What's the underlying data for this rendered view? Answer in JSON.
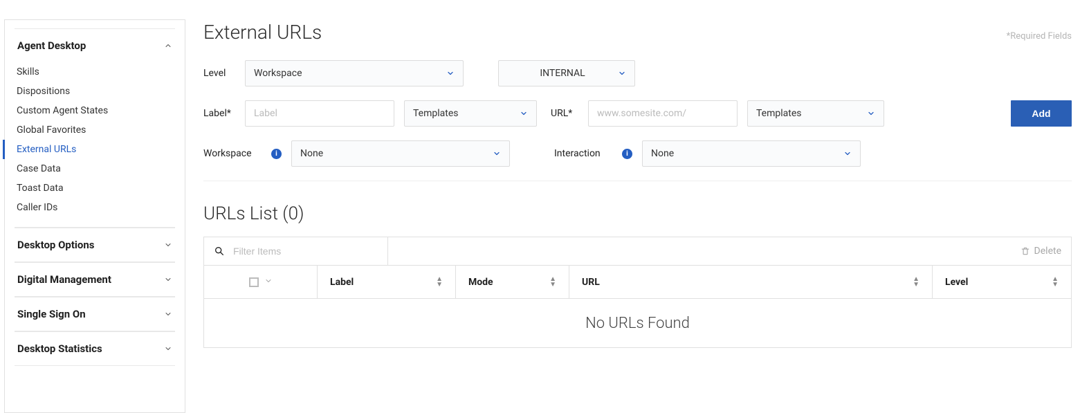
{
  "sidebar": {
    "sections": [
      {
        "title": "Agent Desktop",
        "expanded": true,
        "items": [
          {
            "label": "Skills",
            "active": false
          },
          {
            "label": "Dispositions",
            "active": false
          },
          {
            "label": "Custom Agent States",
            "active": false
          },
          {
            "label": "Global Favorites",
            "active": false
          },
          {
            "label": "External URLs",
            "active": true
          },
          {
            "label": "Case Data",
            "active": false
          },
          {
            "label": "Toast Data",
            "active": false
          },
          {
            "label": "Caller IDs",
            "active": false
          }
        ]
      },
      {
        "title": "Desktop Options",
        "expanded": false,
        "items": []
      },
      {
        "title": "Digital Management",
        "expanded": false,
        "items": []
      },
      {
        "title": "Single Sign On",
        "expanded": false,
        "items": []
      },
      {
        "title": "Desktop Statistics",
        "expanded": false,
        "items": []
      }
    ]
  },
  "page": {
    "title": "External URLs",
    "required_fields_note": "*Required Fields"
  },
  "form": {
    "level": {
      "label": "Level",
      "value": "Workspace"
    },
    "secondary": {
      "value": "INTERNAL"
    },
    "label": {
      "label": "Label*",
      "placeholder": "Label",
      "templates_label": "Templates"
    },
    "url": {
      "label": "URL*",
      "placeholder": "www.somesite.com/",
      "templates_label": "Templates"
    },
    "workspace": {
      "label": "Workspace",
      "value": "None"
    },
    "interaction": {
      "label": "Interaction",
      "value": "None"
    },
    "add_button": "Add"
  },
  "list": {
    "title_prefix": "URLs List",
    "count": 0,
    "filter_placeholder": "Filter Items",
    "delete_label": "Delete",
    "columns": {
      "label": "Label",
      "mode": "Mode",
      "url": "URL",
      "level": "Level"
    },
    "empty_message": "No URLs Found"
  }
}
